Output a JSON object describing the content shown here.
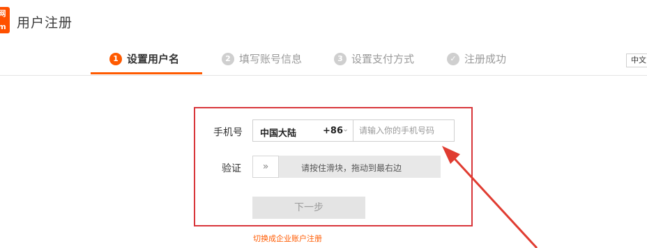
{
  "header": {
    "logo_text": "网",
    "logo_subtext": "m",
    "title": "用户注册"
  },
  "steps": [
    {
      "num": "1",
      "label": "设置用户名",
      "active": true
    },
    {
      "num": "2",
      "label": "填写账号信息",
      "active": false
    },
    {
      "num": "3",
      "label": "设置支付方式",
      "active": false
    },
    {
      "num": "✓",
      "label": "注册成功",
      "active": false
    }
  ],
  "language": "中文",
  "form": {
    "phone_label": "手机号",
    "country": "中国大陆",
    "country_code": "+86",
    "phone_placeholder": "请输入你的手机号码",
    "verify_label": "验证",
    "slider_handle": "»",
    "slider_text": "请按住滑块，拖动到最右边",
    "next_button": "下一步",
    "enterprise_link": "切换成企业账户注册"
  },
  "colors": {
    "accent": "#ff5a00",
    "highlight_border": "#d8353a",
    "arrow": "#e03c31"
  }
}
